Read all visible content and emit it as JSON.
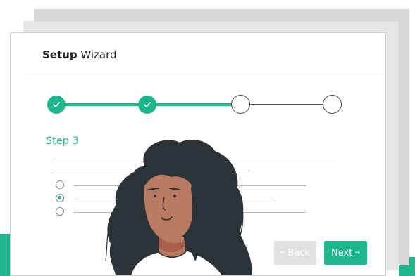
{
  "wizard": {
    "title_bold": "Setup",
    "title_rest": " Wizard",
    "step_label": "Step 3",
    "current_step": 3,
    "total_steps": 4,
    "completed_steps": 2
  },
  "buttons": {
    "back_label": "Back",
    "next_label": "Next",
    "back_arrow": "←",
    "next_arrow": "→"
  },
  "options": [
    {
      "selected": false
    },
    {
      "selected": true
    },
    {
      "selected": false
    }
  ],
  "colors": {
    "accent": "#1eb68c",
    "disabled": "#e0e0e0",
    "hair": "#2b3338",
    "skin": "#b97a62"
  }
}
